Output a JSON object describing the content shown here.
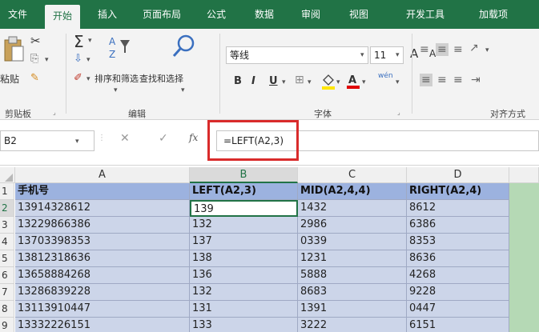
{
  "ribbon_tabs": [
    "文件",
    "开始",
    "插入",
    "页面布局",
    "公式",
    "数据",
    "审阅",
    "视图",
    "开发工具",
    "加载项"
  ],
  "ribbon": {
    "paste_label": "粘贴",
    "sort_filter_label": "排序和筛选",
    "find_select_label": "查找和选择",
    "font_name": "等线",
    "font_size": "11",
    "groups": {
      "clipboard": "剪贴板",
      "editing": "编辑",
      "font": "字体",
      "alignment": "对齐方式"
    },
    "bold_label": "B",
    "italic_label": "I",
    "underline_label": "U",
    "grow_font_label": "A",
    "shrink_font_label": "A",
    "phonetic_label": "wén"
  },
  "formula_bar": {
    "name_box": "B2",
    "fx_label": "fx",
    "formula": "=LEFT(A2,3)"
  },
  "grid": {
    "columns": [
      "A",
      "B",
      "C",
      "D"
    ],
    "row_numbers": [
      "1",
      "2",
      "3",
      "4",
      "5",
      "6",
      "7",
      "8",
      "9"
    ],
    "header_row": [
      "手机号",
      "LEFT(A2,3)",
      "MID(A2,4,4)",
      "RIGHT(A2,4)"
    ],
    "rows": [
      [
        "13914328612",
        "139",
        "1432",
        "8612"
      ],
      [
        "13229866386",
        "132",
        "2986",
        "6386"
      ],
      [
        "13703398353",
        "137",
        "0339",
        "8353"
      ],
      [
        "13812318636",
        "138",
        "1231",
        "8636"
      ],
      [
        "13658884268",
        "136",
        "5888",
        "4268"
      ],
      [
        "13286839228",
        "132",
        "8683",
        "9228"
      ],
      [
        "13113910447",
        "131",
        "1391",
        "0447"
      ],
      [
        "13332226151",
        "133",
        "3222",
        "6151"
      ]
    ],
    "active_cell": "B2"
  },
  "colors": {
    "accent_green": "#217346",
    "header_fill": "#9cb2df",
    "data_fill": "#ccd5e9",
    "highlight_red": "#d92b2b"
  }
}
